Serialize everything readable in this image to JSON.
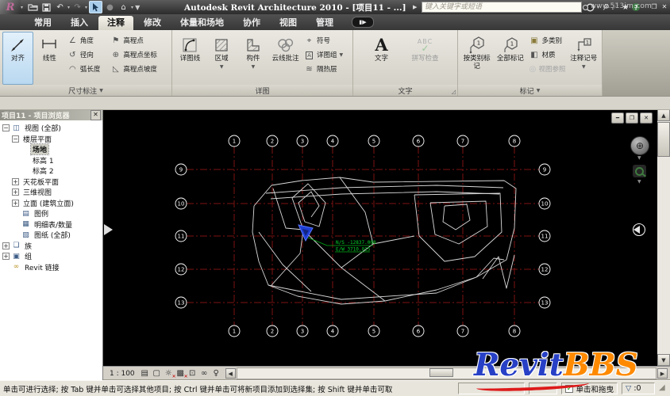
{
  "window": {
    "title": "Autodesk Revit Architecture 2010 - [项目11 - ...]",
    "search_placeholder": "键入关键字或短语",
    "watermark": "www.513im.com",
    "restore_glyph": "❐",
    "close_glyph": "✕"
  },
  "tabs": {
    "items": [
      {
        "id": "home",
        "label": "常用",
        "active": false
      },
      {
        "id": "insert",
        "label": "插入",
        "active": false
      },
      {
        "id": "annotate",
        "label": "注释",
        "active": true
      },
      {
        "id": "modify",
        "label": "修改",
        "active": false
      },
      {
        "id": "massing-site",
        "label": "体量和场地",
        "active": false
      },
      {
        "id": "collaborate",
        "label": "协作",
        "active": false
      },
      {
        "id": "view",
        "label": "视图",
        "active": false
      },
      {
        "id": "manage",
        "label": "管理",
        "active": false
      }
    ]
  },
  "ribbon": {
    "dimension": {
      "panel_label": "尺寸标注",
      "aligned": "对齐",
      "linear": "线性",
      "angle": "角度",
      "radial": "径向",
      "arc_length": "弧长度",
      "spot_elevation": "高程点",
      "spot_coordinate": "高程点坐标",
      "spot_slope": "高程点坡度"
    },
    "detail": {
      "panel_label": "详图",
      "detail_line": "详图线",
      "region": "区域",
      "component": "构件",
      "revision_cloud": "云线批注",
      "symbol": "符号",
      "detail_group": "详图组",
      "insulation": "隔热层"
    },
    "text": {
      "panel_label": "文字",
      "text": "文字",
      "spell_check": "拼写检查"
    },
    "tag": {
      "panel_label": "标记",
      "tag_by_category": "按类别标记",
      "tag_all": "全部标记",
      "multi_category": "多类别",
      "material": "材质",
      "view_reference": "视图参照",
      "keynote": "注释记号"
    }
  },
  "browser": {
    "title": "项目11 - 项目浏览器",
    "tree": [
      {
        "id": "views-all",
        "label": "视图 (全部)",
        "indent": 0,
        "toggle": "-",
        "icon": "views"
      },
      {
        "id": "floor-plans",
        "label": "楼层平面",
        "indent": 1,
        "toggle": "-"
      },
      {
        "id": "site",
        "label": "场地",
        "indent": 2,
        "selected": true
      },
      {
        "id": "level-1",
        "label": "标高 1",
        "indent": 2
      },
      {
        "id": "level-2",
        "label": "标高 2",
        "indent": 2
      },
      {
        "id": "ceiling-plans",
        "label": "天花板平面",
        "indent": 1,
        "toggle": "+"
      },
      {
        "id": "3d-views",
        "label": "三维视图",
        "indent": 1,
        "toggle": "+"
      },
      {
        "id": "elevations",
        "label": "立面 (建筑立面)",
        "indent": 1,
        "toggle": "+"
      },
      {
        "id": "legends",
        "label": "图例",
        "indent": 1,
        "icon": "legend"
      },
      {
        "id": "schedules",
        "label": "明细表/数量",
        "indent": 1,
        "icon": "schedule"
      },
      {
        "id": "sheets",
        "label": "图纸 (全部)",
        "indent": 1,
        "icon": "sheet"
      },
      {
        "id": "families",
        "label": "族",
        "indent": 0,
        "toggle": "+",
        "icon": "family"
      },
      {
        "id": "groups",
        "label": "组",
        "indent": 0,
        "toggle": "+",
        "icon": "group"
      },
      {
        "id": "revit-links",
        "label": "Revit 链接",
        "indent": 0,
        "icon": "link"
      }
    ]
  },
  "canvas": {
    "grid_top_bottom": [
      "1",
      "2",
      "3",
      "4",
      "5",
      "6",
      "7",
      "8"
    ],
    "grid_left_right": [
      "9",
      "10",
      "11",
      "12",
      "13"
    ],
    "spot_coordinate_text": [
      "N/S -12837.008",
      "E/W  3710.015"
    ],
    "mdi_minimize": "━",
    "mdi_restore": "❐",
    "mdi_close": "✕"
  },
  "viewbar": {
    "scale": "1 : 100"
  },
  "statusbar": {
    "hint": "单击可进行选择; 按 Tab 键并单击可选择其他项目; 按 Ctrl 键并单击可将新项目添加到选择集; 按 Shift 键并单击可取",
    "click_drag": "单击和拖曳",
    "filter_count": ":0"
  },
  "logo": {
    "revit": "Revit",
    "bbs": "BBS"
  },
  "colors": {
    "grid_red": "#7e1212",
    "site_line": "#d9d9d9",
    "annotation_green": "#00cc22",
    "marker_blue": "#1e3fd6",
    "selection_blue": "#b9d8f0"
  }
}
